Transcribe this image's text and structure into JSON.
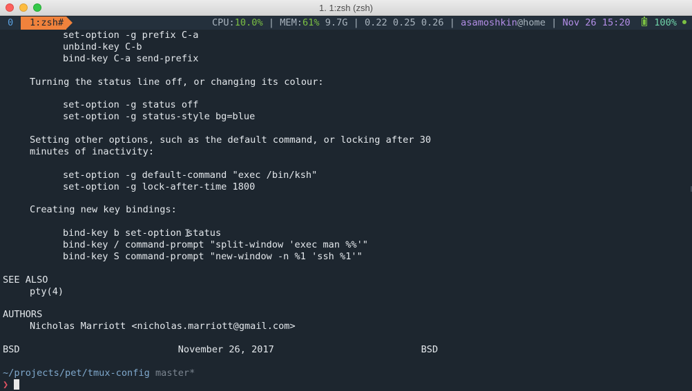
{
  "window": {
    "title": "1. 1:zsh (zsh)"
  },
  "status_bar": {
    "window_index": "0",
    "window_name": "1:zsh#",
    "cpu_label": "CPU:",
    "cpu_value": "10.0%",
    "sep1": " | ",
    "mem_label": "MEM:",
    "mem_percent": "61%",
    "mem_used": " 9.7G",
    "sep2": " | ",
    "load_avg": "0.22 0.25 0.26",
    "sep3": " | ",
    "user_host": "asamoshkin",
    "host": "@home",
    "sep4": " | ",
    "date": "Nov 26",
    "time": " 15:20",
    "battery": "100%",
    "colors": {
      "accent": "#f0823c",
      "green": "#7bc043",
      "purple": "#b48ee8",
      "background": "#1d262f"
    }
  },
  "man_page": {
    "lines": [
      {
        "indent": 2,
        "text": "set-option -g prefix C-a"
      },
      {
        "indent": 2,
        "text": "unbind-key C-b"
      },
      {
        "indent": 2,
        "text": "bind-key C-a send-prefix"
      },
      {
        "indent": 0,
        "text": ""
      },
      {
        "indent": 1,
        "text": "Turning the status line off, or changing its colour:"
      },
      {
        "indent": 0,
        "text": ""
      },
      {
        "indent": 2,
        "text": "set-option -g status off"
      },
      {
        "indent": 2,
        "text": "set-option -g status-style bg=blue"
      },
      {
        "indent": 0,
        "text": ""
      },
      {
        "indent": 1,
        "text": "Setting other options, such as the default command, or locking after 30"
      },
      {
        "indent": 1,
        "text": "minutes of inactivity:"
      },
      {
        "indent": 0,
        "text": ""
      },
      {
        "indent": 2,
        "text": "set-option -g default-command \"exec /bin/ksh\""
      },
      {
        "indent": 2,
        "text": "set-option -g lock-after-time 1800"
      },
      {
        "indent": 0,
        "text": ""
      },
      {
        "indent": 1,
        "text": "Creating new key bindings:"
      },
      {
        "indent": 0,
        "text": ""
      },
      {
        "indent": 2,
        "text": "bind-key b set-option status"
      },
      {
        "indent": 2,
        "text": "bind-key / command-prompt \"split-window 'exec man %%'\""
      },
      {
        "indent": 2,
        "text": "bind-key S command-prompt \"new-window -n %1 'ssh %1'\""
      },
      {
        "indent": 0,
        "text": ""
      },
      {
        "indent": 0,
        "text": "SEE ALSO"
      },
      {
        "indent": 1,
        "text": "pty(4)"
      },
      {
        "indent": 0,
        "text": ""
      },
      {
        "indent": 0,
        "text": "AUTHORS"
      },
      {
        "indent": 1,
        "text": "Nicholas Marriott <nicholas.marriott@gmail.com>"
      },
      {
        "indent": 0,
        "text": ""
      },
      {
        "indent": 0,
        "text": "BSD                            November 26, 2017                          BSD"
      },
      {
        "indent": 0,
        "text": ""
      }
    ]
  },
  "prompt": {
    "path": "~/projects/pet/tmux-config",
    "branch": " master*",
    "symbol": "❯"
  }
}
